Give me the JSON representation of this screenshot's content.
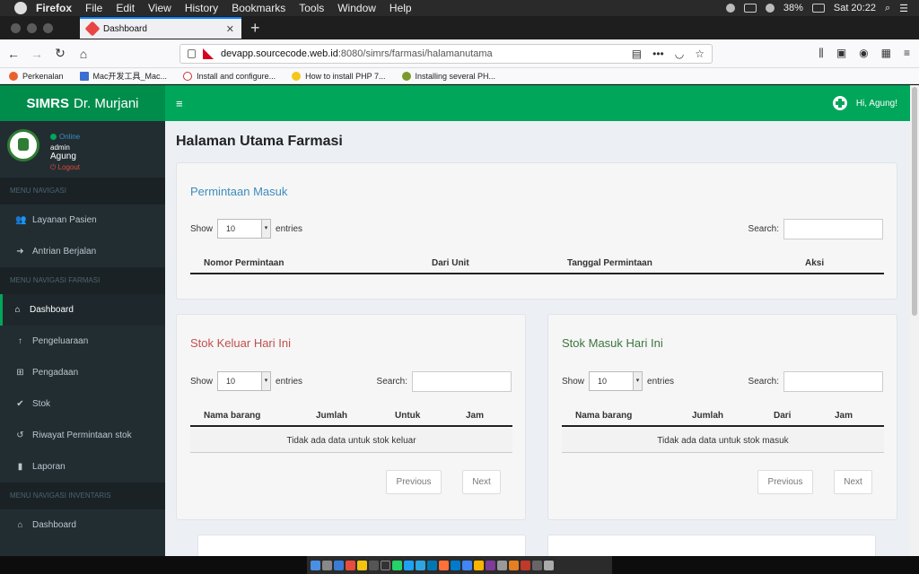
{
  "menubar": {
    "app": "Firefox",
    "items": [
      "File",
      "Edit",
      "View",
      "History",
      "Bookmarks",
      "Tools",
      "Window",
      "Help"
    ],
    "battery": "38%",
    "clock": "Sat 20:22"
  },
  "browser": {
    "tab_title": "Dashboard",
    "url_host": "devapp.sourcecode.web.id",
    "url_path": ":8080/simrs/farmasi/halamanutama",
    "bookmarks": [
      "Perkenalan",
      "Mac开发工具_Mac...",
      "Install and configure...",
      "How to install PHP 7...",
      "Installing several PH..."
    ]
  },
  "app": {
    "logo_bold": "SIMRS",
    "logo_rest": "Dr. Murjani",
    "greeting": "Hi, Agung!"
  },
  "sidebar": {
    "status": "Online",
    "role": "admin",
    "name": "Agung",
    "logout": "Logout",
    "header1": "MENU NAVIGASI",
    "header2": "MENU NAVIGASI FARMASI",
    "header3": "MENU NAVIGASI INVENTARIS",
    "items": [
      {
        "label": "Layanan Pasien",
        "icon": "users-icon"
      },
      {
        "label": "Antrian Berjalan",
        "icon": "arrow-right-icon"
      },
      {
        "label": "Dashboard",
        "icon": "home-icon"
      },
      {
        "label": "Pengeluaraan",
        "icon": "arrow-up-icon"
      },
      {
        "label": "Pengadaan",
        "icon": "cart-icon"
      },
      {
        "label": "Stok",
        "icon": "check-icon"
      },
      {
        "label": "Riwayat Permintaan stok",
        "icon": "history-icon"
      },
      {
        "label": "Laporan",
        "icon": "file-icon"
      },
      {
        "label": "Dashboard",
        "icon": "home-icon"
      }
    ]
  },
  "main": {
    "title": "Halaman Utama Farmasi",
    "permintaan": {
      "title": "Permintaan Masuk",
      "show": "Show",
      "length": "10",
      "entries": "entries",
      "search": "Search:",
      "columns": [
        "Nomor Permintaan",
        "Dari Unit",
        "Tanggal Permintaan",
        "Aksi"
      ]
    },
    "keluar": {
      "title": "Stok Keluar Hari Ini",
      "show": "Show",
      "length": "10",
      "entries": "entries",
      "search": "Search:",
      "columns": [
        "Nama barang",
        "Jumlah",
        "Untuk",
        "Jam"
      ],
      "empty": "Tidak ada data untuk stok keluar",
      "prev": "Previous",
      "next": "Next"
    },
    "masuk": {
      "title": "Stok Masuk Hari Ini",
      "show": "Show",
      "length": "10",
      "entries": "entries",
      "search": "Search:",
      "columns": [
        "Nama barang",
        "Jumlah",
        "Dari",
        "Jam"
      ],
      "empty": "Tidak ada data untuk stok masuk",
      "prev": "Previous",
      "next": "Next"
    }
  },
  "colors": {
    "green_dark": "#008d4c",
    "green": "#00a65a",
    "sidebar": "#222d32",
    "title_blue": "#3c8dbc",
    "title_red": "#c0504d",
    "title_green": "#3c763d"
  }
}
